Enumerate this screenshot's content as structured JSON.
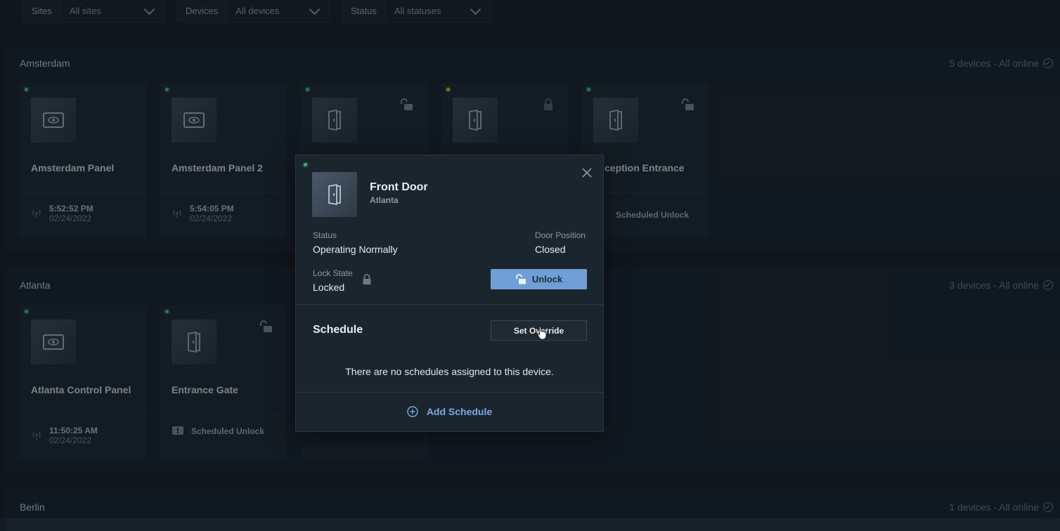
{
  "filters": [
    {
      "label": "Sites",
      "value": "All sites"
    },
    {
      "label": "Devices",
      "value": "All devices"
    },
    {
      "label": "Status",
      "value": "All statuses"
    }
  ],
  "groups": [
    {
      "title": "Amsterdam",
      "count": "5 devices - All online",
      "cards": [
        {
          "name": "Amsterdam Panel",
          "time": "5:52:52 PM",
          "date": "02/24/2022",
          "icon": "panel-icon"
        },
        {
          "name": "Amsterdam Panel 2",
          "time": "5:54:05 PM",
          "date": "02/24/2022",
          "icon": "panel-icon"
        },
        {
          "name": "",
          "icon": "door-icon",
          "lock": "unlocked-icon"
        },
        {
          "name": "",
          "icon": "door-icon",
          "lock": "locked-icon",
          "status": "amber"
        },
        {
          "name": "ception Entrance",
          "footer": "Scheduled Unlock",
          "icon": "door-icon",
          "lock": "unlocked-icon"
        }
      ]
    },
    {
      "title": "Atlanta",
      "count": "3 devices - All online",
      "cards": [
        {
          "name": "Atlanta Control Panel",
          "time": "11:50:25 AM",
          "date": "02/24/2022",
          "icon": "panel-icon"
        },
        {
          "name": "Entrance Gate",
          "footer": "Scheduled Unlock",
          "icon": "door-icon",
          "lock": "unlocked-icon"
        }
      ]
    },
    {
      "title": "Berlin",
      "count": "1 devices - All online"
    }
  ],
  "modal": {
    "title": "Front Door",
    "site": "Atlanta",
    "status_label": "Status",
    "status_value": "Operating Normally",
    "door_position_label": "Door Position",
    "door_position_value": "Closed",
    "lock_state_label": "Lock State",
    "lock_state_value": "Locked",
    "unlock_label": "Unlock",
    "schedule_title": "Schedule",
    "override_label": "Set Override",
    "empty_message": "There are no schedules assigned to this device.",
    "add_schedule_label": "Add Schedule"
  },
  "colors": {
    "accent": "#6f9fd6",
    "online": "#2fb56a",
    "warning": "#c6a431",
    "link": "#79a9e4"
  }
}
